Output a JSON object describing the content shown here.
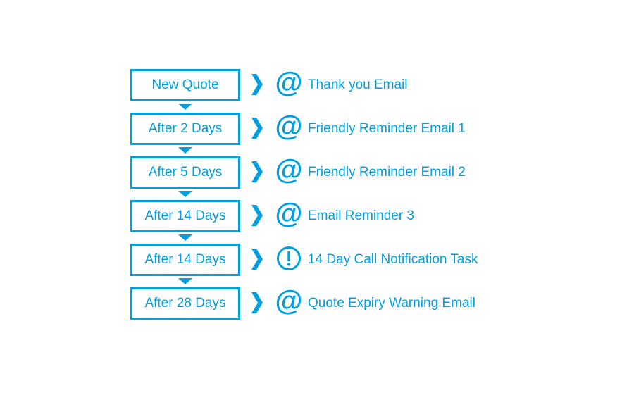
{
  "accent_color": "#00a0e0",
  "steps": [
    {
      "trigger": "New Quote",
      "icon": "at-icon",
      "action": "Thank you Email"
    },
    {
      "trigger": "After 2 Days",
      "icon": "at-icon",
      "action": "Friendly Reminder Email 1"
    },
    {
      "trigger": "After 5 Days",
      "icon": "at-icon",
      "action": "Friendly Reminder Email 2"
    },
    {
      "trigger": "After 14 Days",
      "icon": "at-icon",
      "action": "Email Reminder 3"
    },
    {
      "trigger": "After 14 Days",
      "icon": "exclamation-icon",
      "action": "14 Day Call Notification Task"
    },
    {
      "trigger": "After 28 Days",
      "icon": "at-icon",
      "action": "Quote Expiry Warning Email"
    }
  ]
}
